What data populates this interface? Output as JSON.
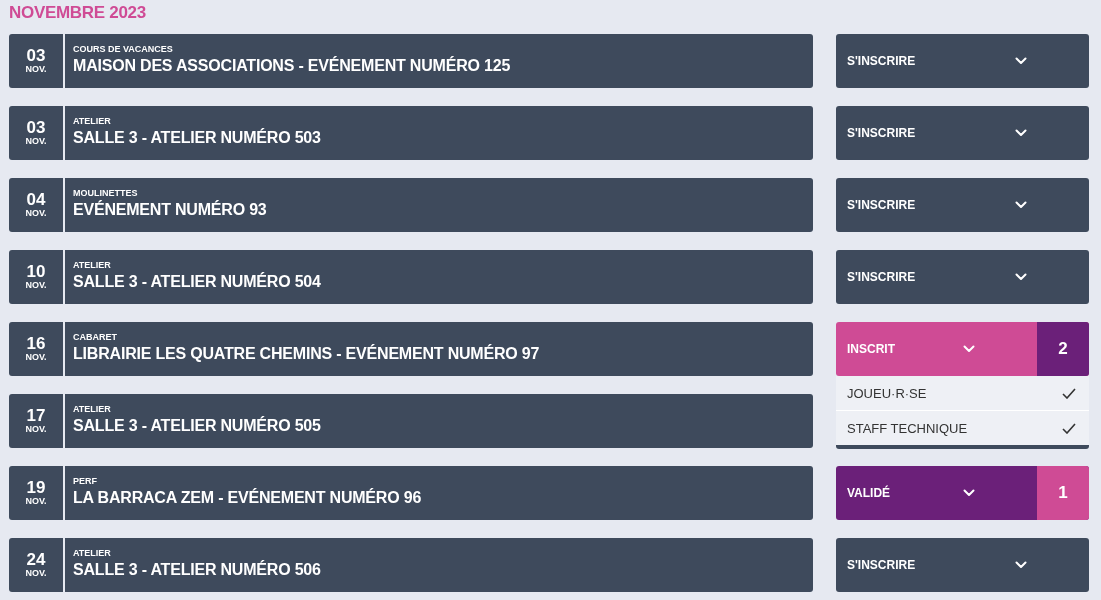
{
  "heading": "NOVEMBRE 2023",
  "events": [
    {
      "day": "03",
      "month": "NOV.",
      "category": "COURS DE VACANCES",
      "title": "MAISON DES ASSOCIATIONS - EVÉNEMENT NUMÉRO 125",
      "action": {
        "kind": "open",
        "label": "S'INSCRIRE"
      }
    },
    {
      "day": "03",
      "month": "NOV.",
      "category": "ATELIER",
      "title": "SALLE 3 - ATELIER NUMÉRO 503",
      "action": {
        "kind": "open",
        "label": "S'INSCRIRE"
      }
    },
    {
      "day": "04",
      "month": "NOV.",
      "category": "MOULINETTES",
      "title": "EVÉNEMENT NUMÉRO 93",
      "action": {
        "kind": "open",
        "label": "S'INSCRIRE"
      }
    },
    {
      "day": "10",
      "month": "NOV.",
      "category": "ATELIER",
      "title": "SALLE 3 - ATELIER NUMÉRO 504",
      "action": {
        "kind": "open",
        "label": "S'INSCRIRE"
      }
    },
    {
      "day": "16",
      "month": "NOV.",
      "category": "CABARET",
      "title": "LIBRAIRIE LES QUATRE CHEMINS - EVÉNEMENT NUMÉRO 97",
      "action": {
        "kind": "registered",
        "label": "INSCRIT",
        "count": "2",
        "expanded": true,
        "options": [
          {
            "label": "JOUEU·R·SE",
            "checked": true
          },
          {
            "label": "STAFF TECHNIQUE",
            "checked": true
          }
        ]
      }
    },
    {
      "day": "17",
      "month": "NOV.",
      "category": "ATELIER",
      "title": "SALLE 3 - ATELIER NUMÉRO 505"
    },
    {
      "day": "19",
      "month": "NOV.",
      "category": "PERF",
      "title": "LA BARRACA ZEM - EVÉNEMENT NUMÉRO 96",
      "action": {
        "kind": "validated",
        "label": "VALIDÉ",
        "count": "1"
      }
    },
    {
      "day": "24",
      "month": "NOV.",
      "category": "ATELIER",
      "title": "SALLE 3 - ATELIER NUMÉRO 506",
      "action": {
        "kind": "open",
        "label": "S'INSCRIRE"
      }
    }
  ]
}
